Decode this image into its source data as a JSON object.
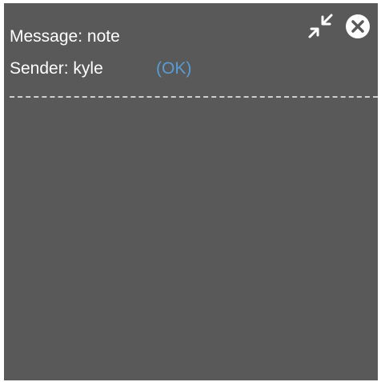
{
  "message": {
    "label": "Message:",
    "value": "note"
  },
  "sender": {
    "label": "Sender:",
    "value": "kyle",
    "status": "(OK)"
  },
  "icons": {
    "collapse": "collapse-arrows-icon",
    "close": "close-circle-icon"
  },
  "colors": {
    "panel_background": "#595959",
    "text": "#ffffff",
    "status_link": "#5b9bd5",
    "divider": "#cfcfcf"
  }
}
